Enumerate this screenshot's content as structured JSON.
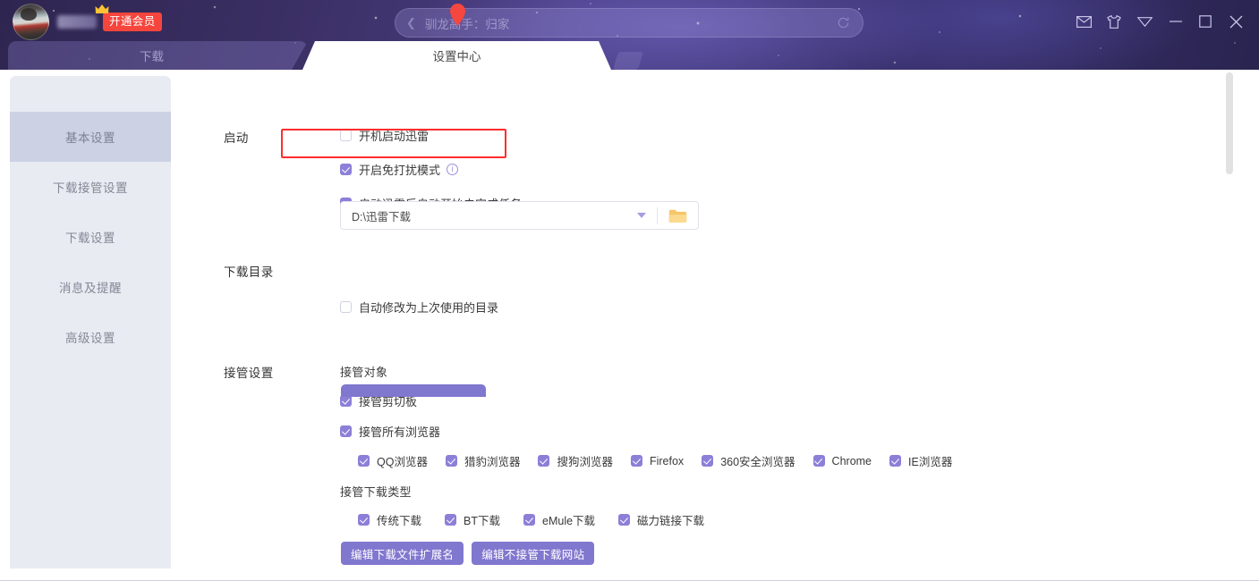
{
  "window": {
    "controls": [
      {
        "name": "mail-icon",
        "label": "邮件"
      },
      {
        "name": "skin-icon",
        "label": "皮肤"
      },
      {
        "name": "menu-icon",
        "label": "主菜单"
      },
      {
        "name": "minimize-icon",
        "label": "最小化"
      },
      {
        "name": "maximize-icon",
        "label": "最大化"
      },
      {
        "name": "close-icon",
        "label": "关闭"
      }
    ]
  },
  "user": {
    "vip_label": "开通会员",
    "crown_icon": "crown-icon",
    "avatar_icon": "avatar"
  },
  "search": {
    "value": "驯龙高手：归家",
    "back_icon": "chevron-left-icon",
    "refresh_icon": "refresh-icon",
    "pin_icon": "map-pin-marker"
  },
  "tabs": [
    {
      "label": "下载",
      "active": false
    },
    {
      "label": "设置中心",
      "active": true
    }
  ],
  "sidebar": {
    "items": [
      {
        "label": "基本设置",
        "active": true
      },
      {
        "label": "下载接管设置",
        "active": false
      },
      {
        "label": "下载设置",
        "active": false
      },
      {
        "label": "消息及提醒",
        "active": false
      },
      {
        "label": "高级设置",
        "active": false
      }
    ]
  },
  "sections": {
    "startup": {
      "label": "启动",
      "options": [
        {
          "label": "开机启动迅雷",
          "checked": false,
          "info": false
        },
        {
          "label": "开启免打扰模式",
          "checked": true,
          "info": true
        },
        {
          "label": "启动迅雷后自动开始未完成任务",
          "checked": true,
          "info": false,
          "highlighted": true
        }
      ]
    },
    "download_dir": {
      "label": "下载目录",
      "path_value": "D:\\迅雷下载",
      "dropdown_icon": "chevron-down-icon",
      "folder_icon": "folder-icon",
      "auto_option": {
        "label": "自动修改为上次使用的目录",
        "checked": false
      }
    },
    "takeover": {
      "label": "接管设置",
      "target_label": "接管对象",
      "targets": [
        {
          "label": "接管剪切板",
          "checked": true
        },
        {
          "label": "接管所有浏览器",
          "checked": true
        }
      ],
      "browsers": [
        {
          "label": "QQ浏览器",
          "checked": true
        },
        {
          "label": "猎豹浏览器",
          "checked": true
        },
        {
          "label": "搜狗浏览器",
          "checked": true
        },
        {
          "label": "Firefox",
          "checked": true
        },
        {
          "label": "360安全浏览器",
          "checked": true
        },
        {
          "label": "Chrome",
          "checked": true
        },
        {
          "label": "IE浏览器",
          "checked": true
        }
      ],
      "types_label": "接管下载类型",
      "types": [
        {
          "label": "传统下载",
          "checked": true
        },
        {
          "label": "BT下载",
          "checked": true
        },
        {
          "label": "eMule下载",
          "checked": true
        },
        {
          "label": "磁力链接下载",
          "checked": true
        }
      ],
      "buttons": [
        {
          "label": "编辑下载文件扩展名"
        },
        {
          "label": "编辑不接管下载网站"
        }
      ]
    }
  },
  "colors": {
    "accent_purple": "#8077cf",
    "checkbox_purple": "#8c7fd8",
    "highlight_red": "#ff2d2d",
    "vip_red": "#f5453c",
    "folder_orange": "#f7c667",
    "sidebar_bg": "#e9ebf2",
    "sidebar_active": "#ccd2e4"
  }
}
